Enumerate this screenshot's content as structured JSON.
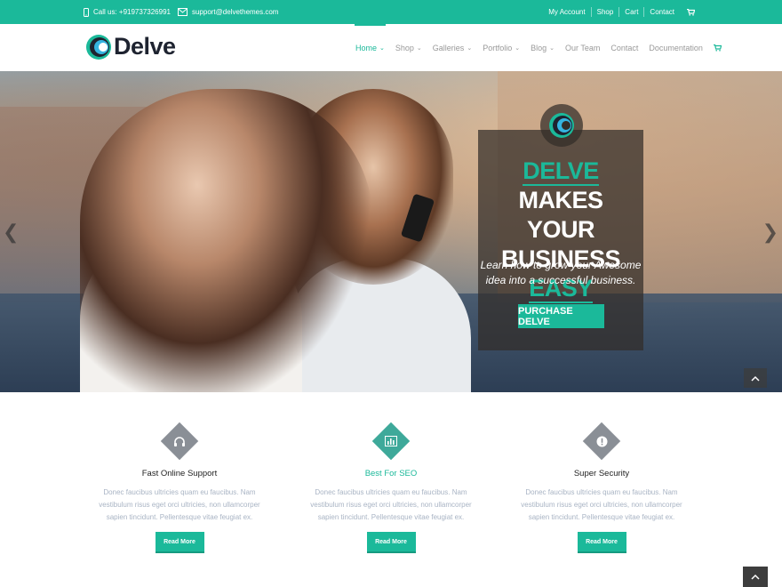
{
  "topbar": {
    "phone": "Call us: +919737326991",
    "email": "support@delvethemes.com",
    "links": [
      "My Account",
      "Shop",
      "Cart",
      "Contact"
    ]
  },
  "header": {
    "logo_text": "Delve",
    "nav": [
      {
        "label": "Home",
        "dropdown": true,
        "active": true
      },
      {
        "label": "Shop",
        "dropdown": true
      },
      {
        "label": "Galleries",
        "dropdown": true
      },
      {
        "label": "Portfolio",
        "dropdown": true
      },
      {
        "label": "Blog",
        "dropdown": true
      },
      {
        "label": "Our Team",
        "dropdown": false
      },
      {
        "label": "Contact",
        "dropdown": false
      },
      {
        "label": "Documentation",
        "dropdown": false
      }
    ]
  },
  "hero": {
    "title_accent_1": "DELVE",
    "title_rest_1": "MAKES",
    "title_line_2": "YOUR",
    "title_line_3_start": "BUSINESS",
    "title_accent_3": "EASY",
    "subtitle": "Learn how to grow your Awesome idea into a successful business.",
    "button": "PURCHASE DELVE"
  },
  "features": [
    {
      "icon": "headphones-icon",
      "title": "Fast Online Support",
      "text": "Donec faucibus ultricies quam eu faucibus. Nam vestibulum risus eget orci ultricies, non ullamcorper sapien tincidunt. Pellentesque vitae feugiat ex.",
      "button": "Read More",
      "highlight": false
    },
    {
      "icon": "bar-chart-icon",
      "title": "Best For SEO",
      "text": "Donec faucibus ultricies quam eu faucibus. Nam vestibulum risus eget orci ultricies, non ullamcorper sapien tincidunt. Pellentesque vitae feugiat ex.",
      "button": "Read More",
      "highlight": true
    },
    {
      "icon": "alert-icon",
      "title": "Super Security",
      "text": "Donec faucibus ultricies quam eu faucibus. Nam vestibulum risus eget orci ultricies, non ullamcorper sapien tincidunt. Pellentesque vitae feugiat ex.",
      "button": "Read More",
      "highlight": false
    }
  ],
  "colors": {
    "accent": "#1bb99a",
    "dark": "#1e2330",
    "muted_text": "#a9b4c4"
  }
}
